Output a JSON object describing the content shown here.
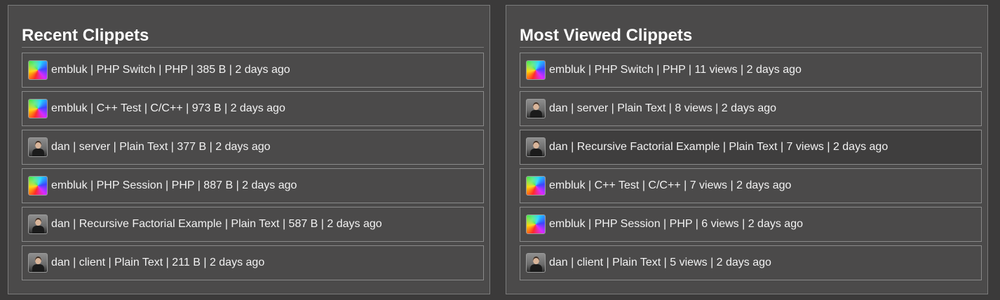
{
  "recent": {
    "title": "Recent Clippets",
    "items": [
      {
        "text": "embluk | PHP Switch | PHP | 385 B | 2 days ago",
        "avatar": "rainbow-avatar-icon"
      },
      {
        "text": "embluk | C++ Test | C/C++ | 973 B | 2 days ago",
        "avatar": "rainbow-avatar-icon"
      },
      {
        "text": "dan | server | Plain Text | 377 B | 2 days ago",
        "avatar": "user-photo-avatar-icon"
      },
      {
        "text": "embluk | PHP Session | PHP | 887 B | 2 days ago",
        "avatar": "rainbow-avatar-icon"
      },
      {
        "text": "dan | Recursive Factorial Example | Plain Text | 587 B | 2 days ago",
        "avatar": "user-photo-avatar-icon"
      },
      {
        "text": "dan | client | Plain Text | 211 B | 2 days ago",
        "avatar": "user-photo-avatar-icon"
      }
    ]
  },
  "most_viewed": {
    "title": "Most Viewed Clippets",
    "items": [
      {
        "text": "embluk | PHP Switch | PHP | 11 views | 2 days ago",
        "avatar": "rainbow-avatar-icon"
      },
      {
        "text": "dan | server | Plain Text | 8 views | 2 days ago",
        "avatar": "user-photo-avatar-icon"
      },
      {
        "text": "dan | Recursive Factorial Example | Plain Text | 7 views | 2 days ago",
        "avatar": "user-photo-avatar-icon"
      },
      {
        "text": "embluk | C++ Test | C/C++ | 7 views | 2 days ago",
        "avatar": "rainbow-avatar-icon"
      },
      {
        "text": "embluk | PHP Session | PHP | 6 views | 2 days ago",
        "avatar": "rainbow-avatar-icon"
      },
      {
        "text": "dan | client | Plain Text | 5 views | 2 days ago",
        "avatar": "user-photo-avatar-icon"
      }
    ]
  },
  "colors": {
    "page_background": "#3b3a3a",
    "panel_background": "#4b4a4a",
    "border": "#8a8a8a",
    "text": "#f2f2f2"
  }
}
